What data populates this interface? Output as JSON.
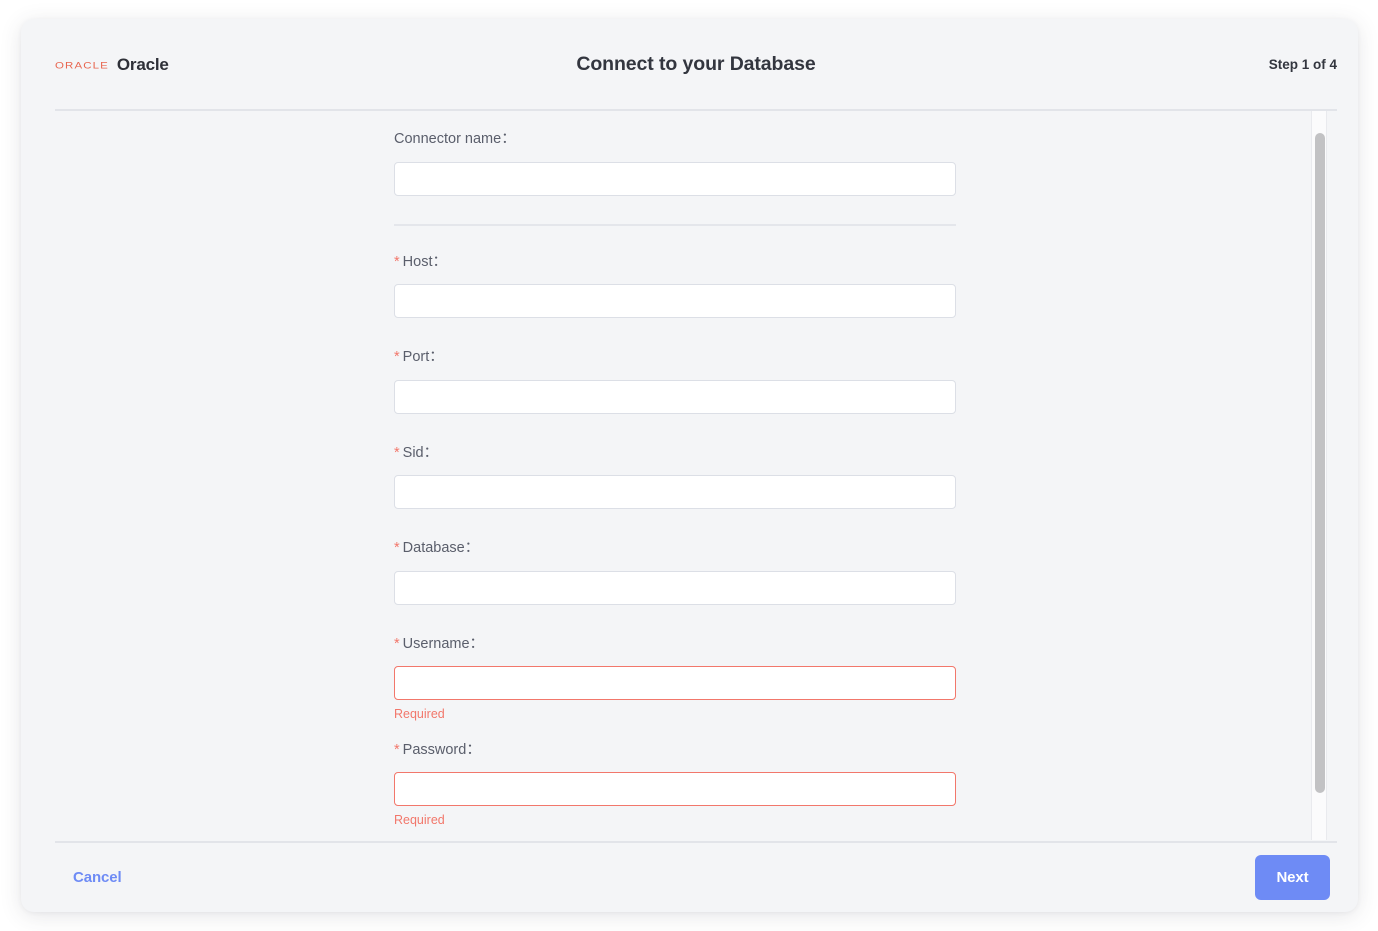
{
  "header": {
    "brand_mark": "ORACLE",
    "brand_name": "Oracle",
    "title": "Connect to your Database",
    "step": "Step 1 of 4"
  },
  "form": {
    "fields": [
      {
        "label": "Connector name：",
        "required": false,
        "value": "",
        "placeholder": "",
        "error": ""
      },
      {
        "label": "Host：",
        "required": true,
        "value": "",
        "placeholder": "",
        "error": ""
      },
      {
        "label": "Port：",
        "required": true,
        "value": "",
        "placeholder": "",
        "error": ""
      },
      {
        "label": "Sid：",
        "required": true,
        "value": "",
        "placeholder": "",
        "error": ""
      },
      {
        "label": "Database：",
        "required": true,
        "value": "",
        "placeholder": "",
        "error": ""
      },
      {
        "label": "Username：",
        "required": true,
        "value": "",
        "placeholder": "",
        "error": "Required"
      },
      {
        "label": "Password：",
        "required": true,
        "value": "",
        "placeholder": "",
        "error": "Required"
      }
    ],
    "required_marker": "*"
  },
  "footer": {
    "cancel_label": "Cancel",
    "next_label": "Next"
  },
  "colors": {
    "accent_blue": "#6e8bf5",
    "error_red": "#f2776b",
    "oracle_red": "#e8654f",
    "card_background": "#f4f5f7",
    "input_border": "#dcdfe6"
  }
}
